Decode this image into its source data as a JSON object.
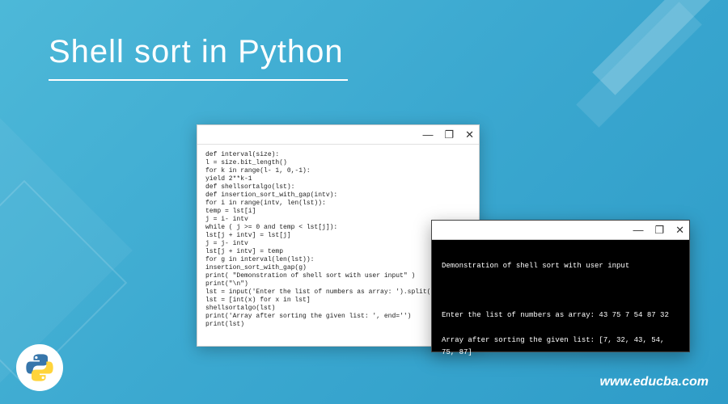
{
  "title": "Shell sort in Python",
  "url": "www.educba.com",
  "windows": {
    "code": {
      "controls": {
        "minimize": "—",
        "maximize": "❐",
        "close": "✕"
      },
      "lines": [
        "def interval(size):",
        "l = size.bit_length()",
        "for k in range(l- 1, 0,-1):",
        "yield 2**k-1",
        "def shellsortalgo(lst):",
        "def insertion_sort_with_gap(intv):",
        "for i in range(intv, len(lst)):",
        "temp = lst[i]",
        "j = i- intv",
        "while ( j >= 0 and temp < lst[j]):",
        "lst[j + intv] = lst[j]",
        "j = j- intv",
        "lst[j + intv] = temp",
        "for g in interval(len(lst)):",
        "insertion_sort_with_gap(g)",
        "print( \"Demonstration of shell sort with user input\" )",
        "print(\"\\n\")",
        "lst = input('Enter the list of numbers as array: ').split()",
        "lst = [int(x) for x in lst]",
        "shellsortalgo(lst)",
        "print('Array after sorting the given list: ', end='')",
        "print(lst)"
      ]
    },
    "terminal": {
      "controls": {
        "minimize": "—",
        "maximize": "❐",
        "close": "✕"
      },
      "line1": "Demonstration of shell sort with user input",
      "line2": "Enter the list of numbers as array: 43 75 7 54 87 32",
      "line3": "Array after sorting the given list: [7, 32, 43, 54, 75, 87]"
    }
  },
  "logo": {
    "name": "python-logo"
  }
}
